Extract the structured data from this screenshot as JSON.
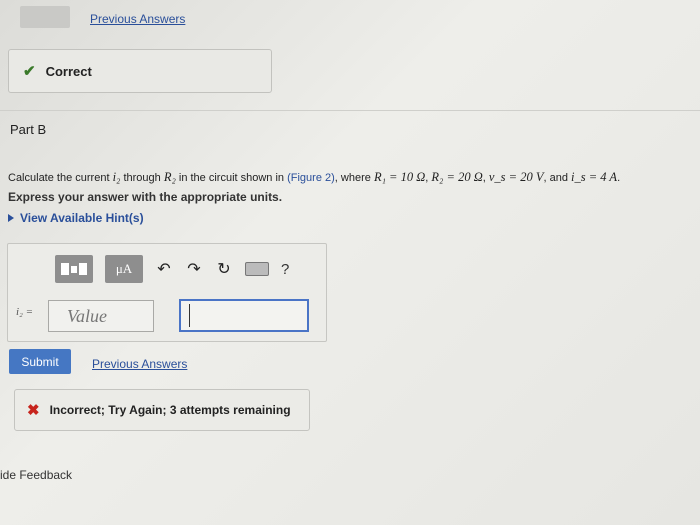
{
  "header": {
    "previous_answers": "Previous Answers"
  },
  "status": {
    "text": "Correct",
    "icon": "check-icon",
    "color": "#3a7a2a"
  },
  "part": {
    "title": "Part B"
  },
  "question": {
    "pre": "Calculate the current",
    "i2": "i₂",
    "through": "through",
    "r2": "R₂",
    "mid": "in the circuit shown in",
    "figure": "(Figure 2)",
    "where": ", where",
    "r1_eq": "R₁ = 10 Ω",
    "r2_eq": "R₂ = 20 Ω",
    "vs_eq": "v_s = 20 V",
    "and": ", and",
    "is_eq": "i_s = 4 A",
    "end": "."
  },
  "instruction": "Express your answer with the appropriate units.",
  "hints": {
    "label": "View Available Hint(s)"
  },
  "toolbar": {
    "units_label": "μA",
    "help": "?"
  },
  "answer": {
    "label": "i₂ =",
    "value_placeholder": "Value",
    "units_value": ""
  },
  "actions": {
    "submit_label": "Submit",
    "previous_answers": "Previous Answers"
  },
  "feedback": {
    "incorrect_text": "Incorrect; Try Again; 3 attempts remaining",
    "icon": "x-icon",
    "color": "#c7241d"
  },
  "footer": {
    "feedback_link": "ide Feedback"
  }
}
